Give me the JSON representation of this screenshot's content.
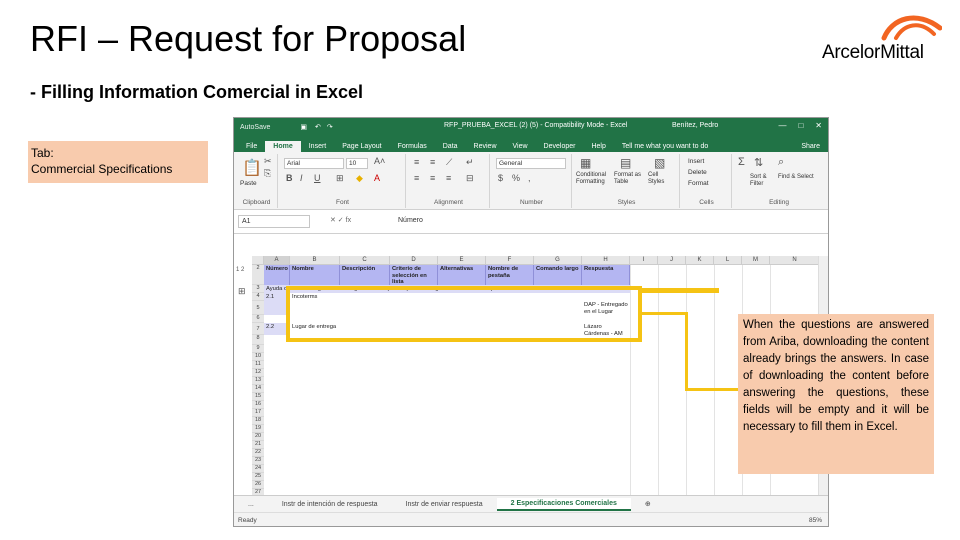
{
  "slide": {
    "title": "RFI – Request for Proposal",
    "subtitle": "- Filling Information Comercial in Excel",
    "logo_text": "ArcelorMittal",
    "tab_callout_line1": "Tab:",
    "tab_callout_line2": "Commercial Specifications",
    "note_callout": "When the questions are answered from Ariba, downloading the content already brings the answers. In case of downloading the content before answering the questions, these fields will be empty and it will be necessary to fill them in Excel.",
    "colors": {
      "highlight": "#f5c314",
      "callout_bg": "#f8cbad",
      "excel_green": "#217346",
      "header_fill": "#b4b6f2"
    }
  },
  "excel": {
    "autosave": "AutoSave",
    "title": "RFP_PRUEBA_EXCEL (2) (5) - Compatibility Mode - Excel",
    "user": "Benítez, Pedro",
    "ribbon_tabs": [
      "File",
      "Home",
      "Insert",
      "Page Layout",
      "Formulas",
      "Data",
      "Review",
      "View",
      "Developer",
      "Help",
      "Tell me what you want to do"
    ],
    "share": "Share",
    "font_name": "Arial",
    "font_size": "10",
    "number_format": "General",
    "groups": [
      "Clipboard",
      "Font",
      "Alignment",
      "Number",
      "Styles",
      "Cells",
      "Editing"
    ],
    "paste": "Paste",
    "cond_format": "Conditional Formatting",
    "format_table": "Format as Table",
    "cell_styles": "Cell Styles",
    "insert": "Insert",
    "delete": "Delete",
    "format": "Format",
    "sort_filter": "Sort & Filter",
    "find_select": "Find & Select",
    "name_box": "A1",
    "formula_value": "Número",
    "columns": [
      "A",
      "B",
      "C",
      "D",
      "E",
      "F",
      "G",
      "H",
      "I",
      "J",
      "K",
      "L",
      "M",
      "N"
    ],
    "header_cells": [
      "Número",
      "Nombre",
      "Descripción",
      "Criterio de selección en lista",
      "Alternativas",
      "Nombre de pestaña",
      "Comando largo",
      "Respuesta"
    ],
    "help_row": "Ayuda    opciones. Haga clic en el signo + a la izquierda para conseguir más información para rellenar las celdas",
    "row1": {
      "num": "2.1",
      "name": "Incoterms",
      "answer": "DAP - Entregado en el Lugar"
    },
    "row2": {
      "num": "2.2",
      "name": "Lugar de entrega",
      "answer": "Lázaro Cárdenas - AM"
    },
    "row_numbers": [
      "1",
      "2",
      "3",
      "4",
      "5",
      "6",
      "7",
      "8",
      "9",
      "10",
      "11",
      "12",
      "13",
      "14",
      "15",
      "16",
      "17",
      "18",
      "19",
      "20",
      "21",
      "22",
      "23",
      "24",
      "25",
      "26",
      "27"
    ],
    "sheet_tabs": [
      "...",
      "Instr de intención de respuesta",
      "Instr de enviar respuesta",
      "2 Especificaciones Comerciales"
    ],
    "status": "Ready",
    "zoom": "85%"
  }
}
